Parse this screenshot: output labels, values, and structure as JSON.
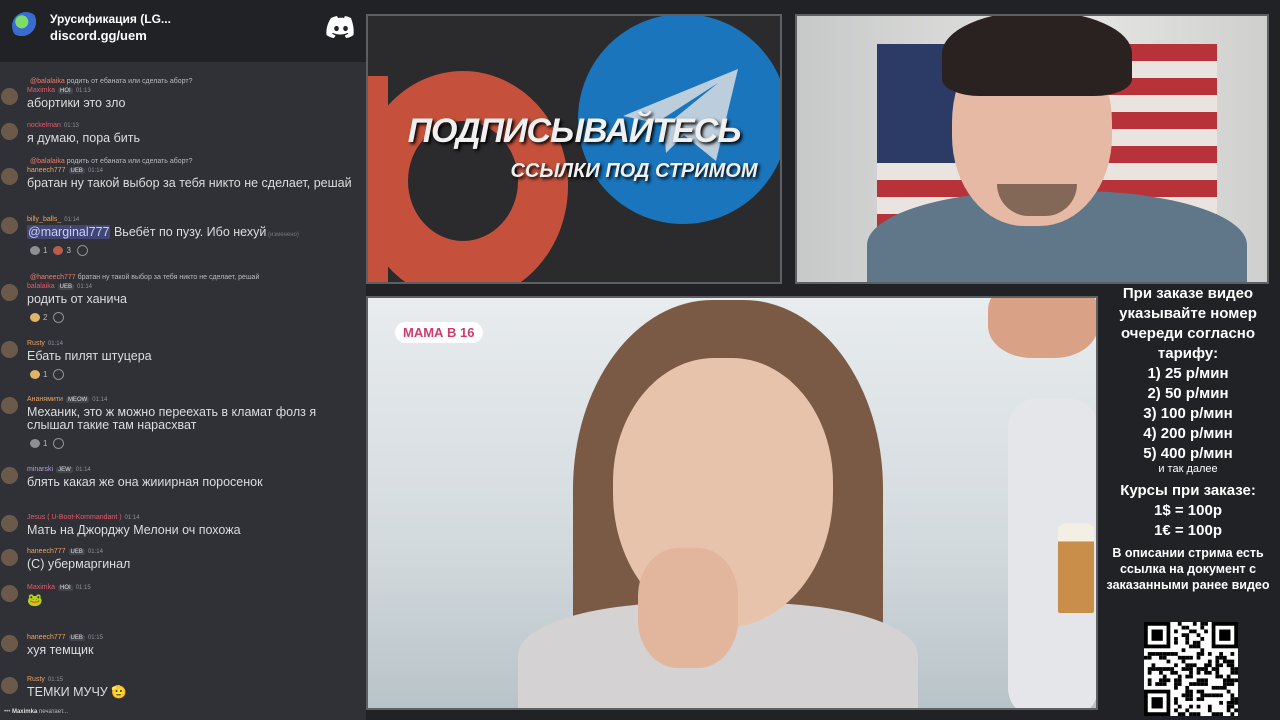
{
  "discord": {
    "server_name": "Урусификация (LG...",
    "server_link": "discord.gg/uem",
    "typing_user": "Maximka",
    "typing_suffix": "печатает..."
  },
  "messages": [
    {
      "reply_to": "@balalaika",
      "reply_text": "родить от ебаната или сделать аборт?",
      "author": "Maximka",
      "author_color": "#e8596b",
      "badge": "HOI",
      "time": "01:13",
      "text": "абортики это зло"
    },
    {
      "author": "nockelman",
      "author_color": "#e8596b",
      "time": "01:13",
      "text": "я думаю, пора бить"
    },
    {
      "reply_to": "@balalaika",
      "reply_text": "родить от ебаната или сделать аборт?",
      "author": "haneech777",
      "author_color": "#f0a35e",
      "badge": "UEB",
      "time": "01:14",
      "text": "братан ну такой выбор за тебя никто не сделает, решай"
    },
    {
      "author": "billy_balls_",
      "author_color": "#f0a35e",
      "time": "01:14",
      "mention": "@marginal777",
      "text": "Вьебёт по пузу. Ибо нехуй",
      "edited": "(изменено)",
      "reactions": [
        {
          "icon": "speech",
          "count": "1"
        },
        {
          "icon": "heart",
          "count": "3"
        }
      ]
    },
    {
      "reply_to": "@haneech777",
      "reply_text": "братан ну такой выбор за тебя никто не сделает, решай",
      "author": "balalaika",
      "author_color": "#e8596b",
      "badge": "UEB",
      "time": "01:14",
      "text": "родить от ханича",
      "reactions": [
        {
          "icon": "clap",
          "count": "2"
        }
      ]
    },
    {
      "author": "Rusty",
      "author_color": "#f0a35e",
      "time": "01:14",
      "text": "Ебать пилят штуцера",
      "reactions": [
        {
          "icon": "clap",
          "count": "1"
        }
      ]
    },
    {
      "author": "Ананямити",
      "author_color": "#f0a35e",
      "badge": "MEOW",
      "time": "01:14",
      "text": "Механик, это ж можно переехать в кламат фолз я слышал такие там нарасхват",
      "reactions": [
        {
          "icon": "speech",
          "count": "1"
        }
      ]
    },
    {
      "author": "minarski",
      "author_color": "#b69ae0",
      "badge": "JEW",
      "time": "01:14",
      "text": "блять какая же она жииирная поросенок"
    },
    {
      "author": "Jesus ( U-Boot-Kommandant )",
      "author_color": "#e8596b",
      "time": "01:14",
      "text": "Мать на Джорджу Мелони оч похожа"
    },
    {
      "author": "haneech777",
      "author_color": "#f0a35e",
      "badge": "UEB",
      "time": "01:14",
      "text": "(C) убермаргинал"
    },
    {
      "author": "Maximka",
      "author_color": "#e8596b",
      "badge": "HOI",
      "time": "01:15",
      "text": "🐸"
    },
    {
      "author": "haneech777",
      "author_color": "#f0a35e",
      "badge": "UEB",
      "time": "01:15",
      "text": "хуя темщик"
    },
    {
      "author": "Rusty",
      "author_color": "#f0a35e",
      "time": "01:15",
      "text": "ТЕМКИ МУЧУ 🫡"
    }
  ],
  "promo": {
    "title": "ПОДПИСЫВАЙТЕСЬ",
    "subtitle": "ССЫЛКИ ПОД СТРИМОМ"
  },
  "video": {
    "show_badge": "МАМА В 16"
  },
  "order_info": {
    "heading": "При заказе видео указывайте номер очереди согласно тарифу:",
    "tariffs": [
      "1) 25 р/мин",
      "2) 50 р/мин",
      "3) 100 р/мин",
      "4) 200 р/мин",
      "5) 400 р/мин"
    ],
    "tariff_more": "и так далее",
    "rates_heading": "Курсы при заказе:",
    "rates": [
      "1$ = 100р",
      "1€ = 100р"
    ],
    "description": "В описании стрима есть ссылка на документ с заказанными ранее видео"
  },
  "colors": {
    "discord_bg": "#2f3136",
    "discord_header": "#202225",
    "patreon": "#c5513c",
    "telegram": "#1b75bc",
    "badge_pink": "#d03b6a"
  },
  "icons": [
    "discord-logo-icon",
    "telegram-plane-icon",
    "patreon-logo-icon",
    "qr-code"
  ]
}
